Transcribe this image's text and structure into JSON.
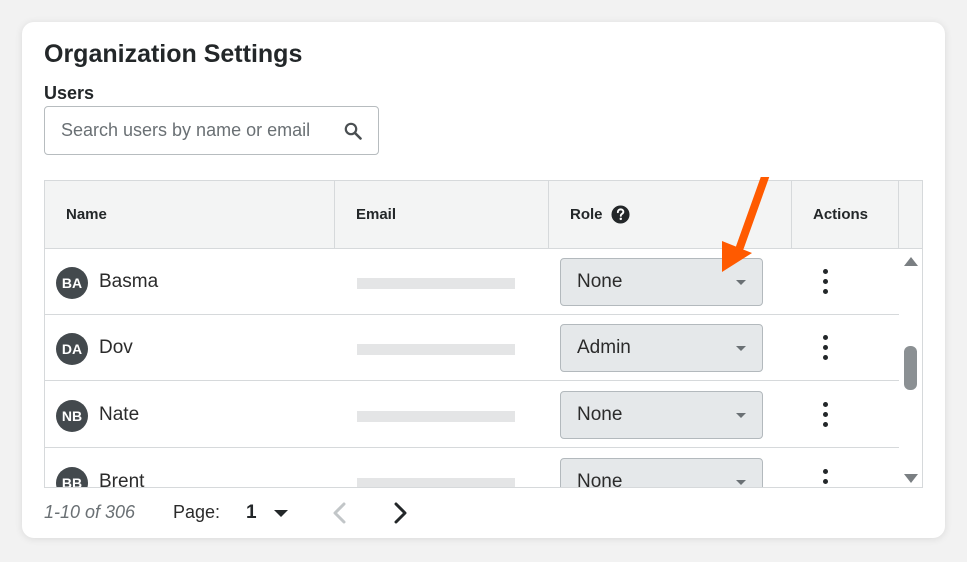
{
  "page": {
    "title": "Organization Settings",
    "section_label": "Users"
  },
  "search": {
    "placeholder": "Search users by name or email",
    "value": "",
    "icon": "search-icon"
  },
  "table": {
    "columns": [
      {
        "label": "Name"
      },
      {
        "label": "Email"
      },
      {
        "label": "Role",
        "icon": "help-icon"
      },
      {
        "label": "Actions"
      }
    ],
    "rows": [
      {
        "initials": "BA",
        "name": "Basma",
        "role": "None"
      },
      {
        "initials": "DA",
        "name": "Dov",
        "role": "Admin"
      },
      {
        "initials": "NB",
        "name": "Nate",
        "role": "None"
      },
      {
        "initials": "BB",
        "name": "Brent",
        "role": "None"
      }
    ]
  },
  "pagination": {
    "range_text": "1-10 of 306",
    "page_label": "Page:",
    "current_page": "1"
  },
  "annotation": {
    "arrow_color": "#ff5a00"
  },
  "colors": {
    "avatar_bg": "#43494d",
    "select_bg": "#e5e8ea",
    "header_bg": "#f3f4f4"
  }
}
